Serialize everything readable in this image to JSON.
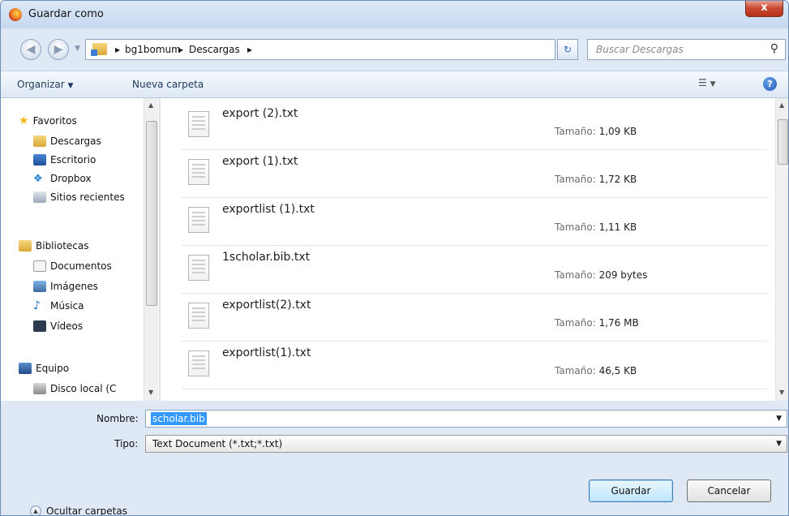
{
  "window": {
    "title": "Guardar como",
    "close_glyph": "x"
  },
  "address": {
    "crumbs": [
      "bg1bomum",
      "Descargas"
    ],
    "separator": "▸",
    "search_placeholder": "Buscar Descargas"
  },
  "toolbar": {
    "organize": "Organizar",
    "new_folder": "Nueva carpeta"
  },
  "nav": {
    "groups": [
      {
        "label": "Favoritos",
        "icon": "star-icon",
        "items": [
          {
            "label": "Descargas",
            "icon": "downloads-folder-icon"
          },
          {
            "label": "Escritorio",
            "icon": "desktop-icon"
          },
          {
            "label": "Dropbox",
            "icon": "dropbox-icon"
          },
          {
            "label": "Sitios recientes",
            "icon": "recent-places-icon"
          }
        ]
      },
      {
        "label": "Bibliotecas",
        "icon": "libraries-icon",
        "items": [
          {
            "label": "Documentos",
            "icon": "documents-icon"
          },
          {
            "label": "Imágenes",
            "icon": "pictures-icon"
          },
          {
            "label": "Música",
            "icon": "music-icon"
          },
          {
            "label": "Vídeos",
            "icon": "videos-icon"
          }
        ]
      },
      {
        "label": "Equipo",
        "icon": "computer-icon",
        "items": [
          {
            "label": "Disco local (C",
            "icon": "local-disk-icon"
          }
        ]
      }
    ]
  },
  "files": {
    "size_label": "Tamaño:",
    "items": [
      {
        "name": "export (2).txt",
        "size": "1,09 KB"
      },
      {
        "name": "export (1).txt",
        "size": "1,72 KB"
      },
      {
        "name": "exportlist (1).txt",
        "size": "1,11 KB"
      },
      {
        "name": "1scholar.bib.txt",
        "size": "209 bytes"
      },
      {
        "name": "exportlist(2).txt",
        "size": "1,76 MB"
      },
      {
        "name": "exportlist(1).txt",
        "size": "46,5 KB"
      }
    ]
  },
  "form": {
    "name_label": "Nombre:",
    "name_value": "scholar.bib",
    "type_label": "Tipo:",
    "type_value": "Text Document (*.txt;*.txt)",
    "hide_folders": "Ocultar carpetas",
    "save": "Guardar",
    "cancel": "Cancelar"
  }
}
